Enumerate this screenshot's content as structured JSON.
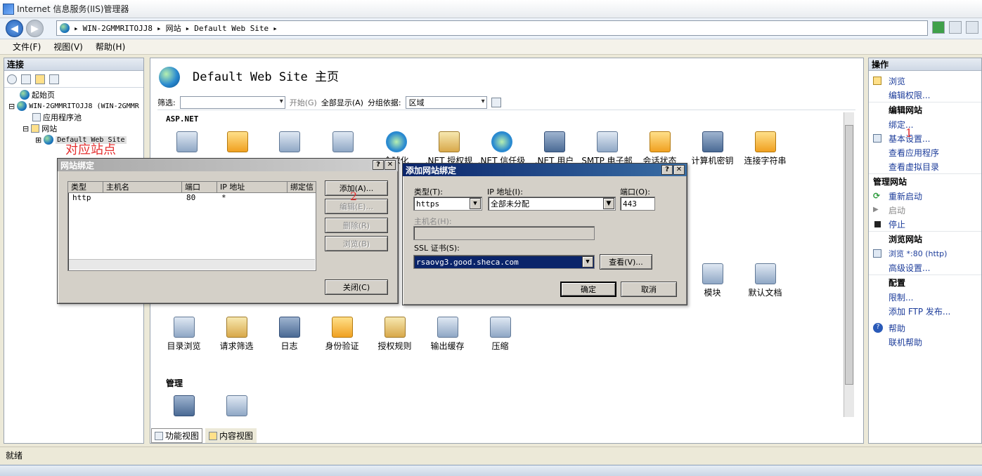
{
  "window": {
    "title": "Internet 信息服务(IIS)管理器"
  },
  "address": {
    "segments": [
      "WIN-2GMMRITOJJ8",
      "网站",
      "Default Web Site"
    ]
  },
  "menu": {
    "file": "文件(F)",
    "view": "视图(V)",
    "help": "帮助(H)"
  },
  "connections": {
    "header": "连接",
    "tree": {
      "start_page": "起始页",
      "server": "WIN-2GMMRITOJJ8 (WIN-2GMMR",
      "app_pools": "应用程序池",
      "sites": "网站",
      "default_site": "Default Web Site"
    }
  },
  "center": {
    "title": "Default Web Site 主页",
    "filter_label": "筛选:",
    "start_btn": "开始(G)",
    "show_all": "全部显示(A)",
    "group_by": "分组依据:",
    "group_value": "区域",
    "section_aspnet": "ASP.NET",
    "section_manage": "管理",
    "icons_row1": [
      "全球化",
      ".NET 授权规",
      ".NET 信任级",
      ".NET 用户",
      "SMTP 电子邮",
      "会话状态",
      "计算机密钥",
      "连接字符串"
    ],
    "icons_iis": [
      "模块",
      "默认文档"
    ],
    "icons_row3": [
      "目录浏览",
      "请求筛选",
      "日志",
      "身份验证",
      "授权规则",
      "输出缓存",
      "压缩"
    ],
    "tab_features": "功能视图",
    "tab_content": "内容视图"
  },
  "actions": {
    "header": "操作",
    "browse": "浏览",
    "edit_perms": "编辑权限...",
    "edit_site_head": "编辑网站",
    "bindings": "绑定...",
    "basic_settings": "基本设置...",
    "view_apps": "查看应用程序",
    "view_vdirs": "查看虚拟目录",
    "manage_site_head": "管理网站",
    "restart": "重新启动",
    "start": "启动",
    "stop": "停止",
    "browse_site_head": "浏览网站",
    "browse_80": "浏览 *:80 (http)",
    "advanced": "高级设置...",
    "config_head": "配置",
    "limits": "限制...",
    "add_ftp": "添加 FTP 发布...",
    "help": "帮助",
    "online_help": "联机帮助"
  },
  "status": {
    "text": "就绪"
  },
  "site_bindings_dialog": {
    "title": "网站绑定",
    "columns": [
      "类型",
      "主机名",
      "端口",
      "IP 地址",
      "绑定信"
    ],
    "rows": [
      {
        "type": "http",
        "host": "",
        "port": "80",
        "ip": "*"
      }
    ],
    "add": "添加(A)...",
    "edit": "编辑(E)...",
    "remove": "删除(R)",
    "browse": "浏览(B)",
    "close": "关闭(C)"
  },
  "add_binding_dialog": {
    "title": "添加网站绑定",
    "type_label": "类型(T):",
    "type_value": "https",
    "ip_label": "IP 地址(I):",
    "ip_value": "全部未分配",
    "port_label": "端口(O):",
    "port_value": "443",
    "host_label": "主机名(H):",
    "host_value": "",
    "ssl_label": "SSL 证书(S):",
    "ssl_value": "rsaovg3.good.sheca.com",
    "view_btn": "查看(V)...",
    "ok": "确定",
    "cancel": "取消"
  },
  "annotations": {
    "site_note": "对应站点",
    "n1": "1",
    "n2": "2"
  },
  "colors": {
    "accent": "#0a246a",
    "annotation": "#e53030",
    "link": "#1c3c9a"
  }
}
